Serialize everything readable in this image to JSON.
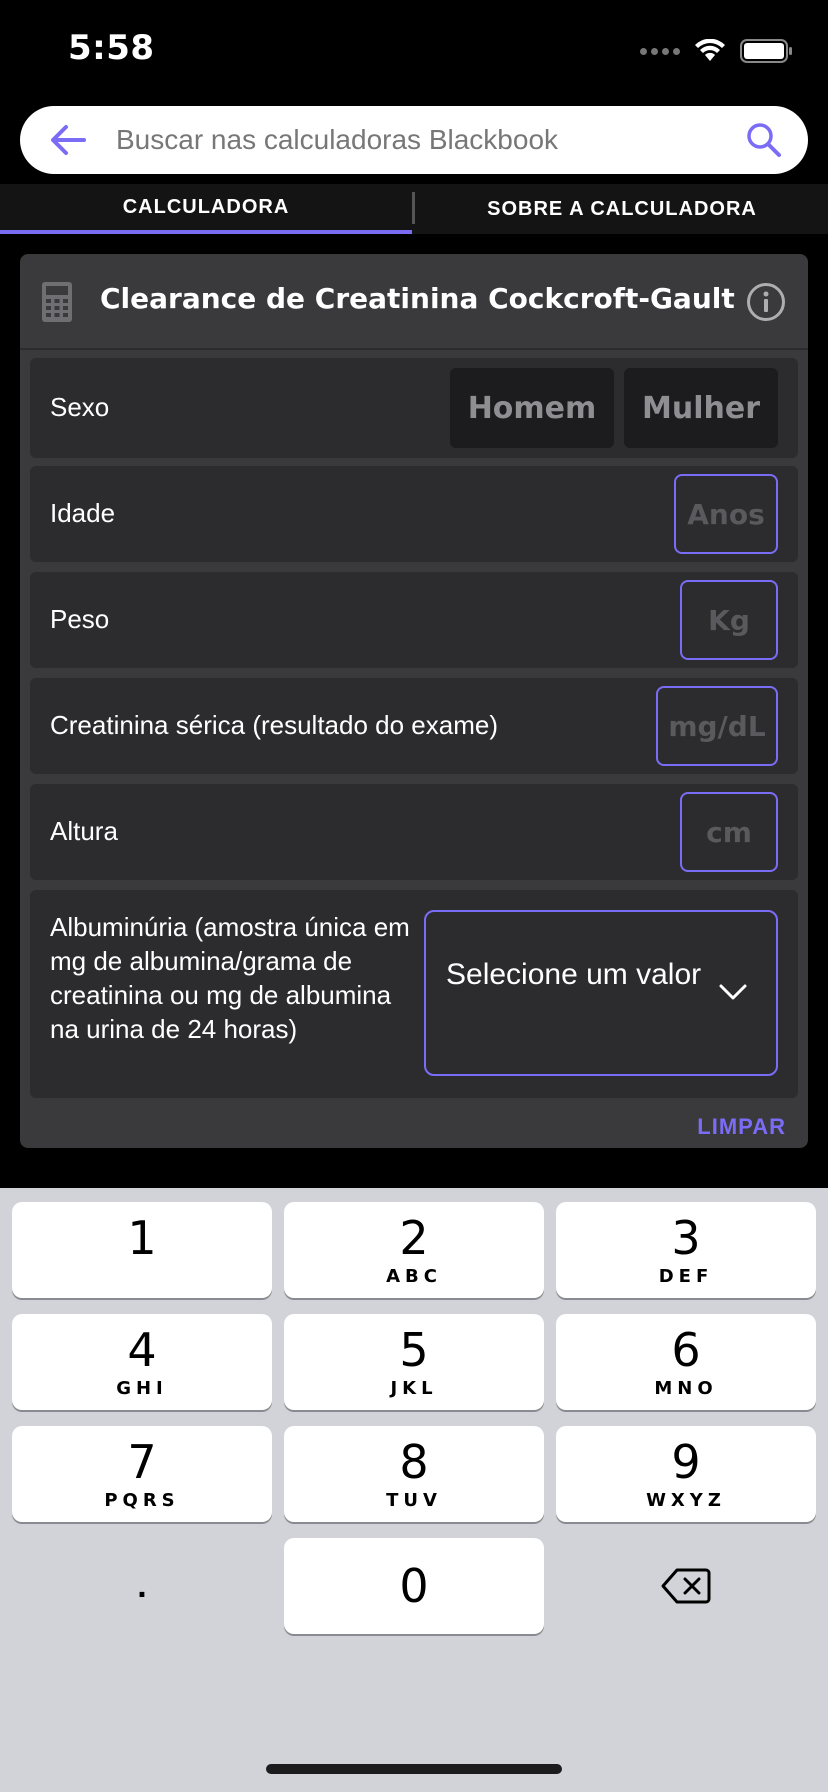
{
  "status_bar": {
    "time": "5:58",
    "icons": [
      "signal-icon",
      "wifi-icon",
      "battery-icon"
    ]
  },
  "search": {
    "placeholder": "Buscar nas calculadoras Blackbook",
    "back_icon": "arrow-left-icon",
    "search_icon": "magnifier-icon"
  },
  "tabs": [
    {
      "label": "CALCULADORA",
      "active": true
    },
    {
      "label": "SOBRE A CALCULADORA",
      "active": false
    }
  ],
  "calculator": {
    "title": "Clearance de Creatinina Cockcroft-Gault",
    "icon": "calculator-icon",
    "info_icon": "info-icon",
    "fields": {
      "sexo": {
        "label": "Sexo",
        "options": [
          "Homem",
          "Mulher"
        ]
      },
      "idade": {
        "label": "Idade",
        "placeholder": "Anos",
        "value": ""
      },
      "peso": {
        "label": "Peso",
        "placeholder": "Kg",
        "value": ""
      },
      "creatinina": {
        "label": "Creatinina sérica (resultado do exame)",
        "placeholder": "mg/dL",
        "value": ""
      },
      "altura": {
        "label": "Altura",
        "placeholder": "cm",
        "value": ""
      },
      "albuminuria": {
        "label": "Albuminúria (amostra única em mg de albumina/grama de creatinina ou mg de albumina na urina de 24 horas)",
        "selected": "Selecione um valor"
      }
    },
    "clear_label": "LIMPAR"
  },
  "keyboard": {
    "keys": [
      {
        "num": "1",
        "letters": ""
      },
      {
        "num": "2",
        "letters": "ABC"
      },
      {
        "num": "3",
        "letters": "DEF"
      },
      {
        "num": "4",
        "letters": "GHI"
      },
      {
        "num": "5",
        "letters": "JKL"
      },
      {
        "num": "6",
        "letters": "MNO"
      },
      {
        "num": "7",
        "letters": "PQRS"
      },
      {
        "num": "8",
        "letters": "TUV"
      },
      {
        "num": "9",
        "letters": "WXYZ"
      }
    ],
    "decimal": ".",
    "zero": "0",
    "delete_icon": "backspace-icon"
  },
  "colors": {
    "accent": "#7b6cf6",
    "card_bg": "#3a3a3c",
    "row_bg": "#2c2c2e",
    "keyboard_bg": "#d1d3d9"
  }
}
